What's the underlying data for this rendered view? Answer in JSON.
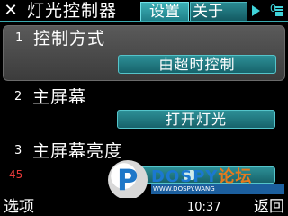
{
  "title_bar": {
    "close_icon": "close-icon",
    "app_title": "灯光控制器",
    "tabs": [
      {
        "label": "设置",
        "active": true
      },
      {
        "label": "关于",
        "active": false
      }
    ],
    "more_tabs_icon": "arrow-right-icon",
    "status_digit": "0",
    "battery_icon": "battery-icon",
    "accent_color": "#3fd2d8"
  },
  "settings": [
    {
      "index": "1",
      "title": "控制方式",
      "value": "由超时控制",
      "highlighted": true
    },
    {
      "index": "2",
      "title": "主屏幕",
      "value": "打开灯光",
      "highlighted": false
    },
    {
      "index": "3",
      "title": "主屏幕亮度",
      "slider_value": "45",
      "slider_max": 100,
      "value_color": "#e83a3a"
    }
  ],
  "watermark": {
    "logo_letter": "P",
    "brand": "DOSPY",
    "brand_cn": "论坛",
    "subtitle": "WWW.DOSPY.WANG"
  },
  "softkeys": {
    "left": "选项",
    "clock": "10:37",
    "right": "返回"
  }
}
